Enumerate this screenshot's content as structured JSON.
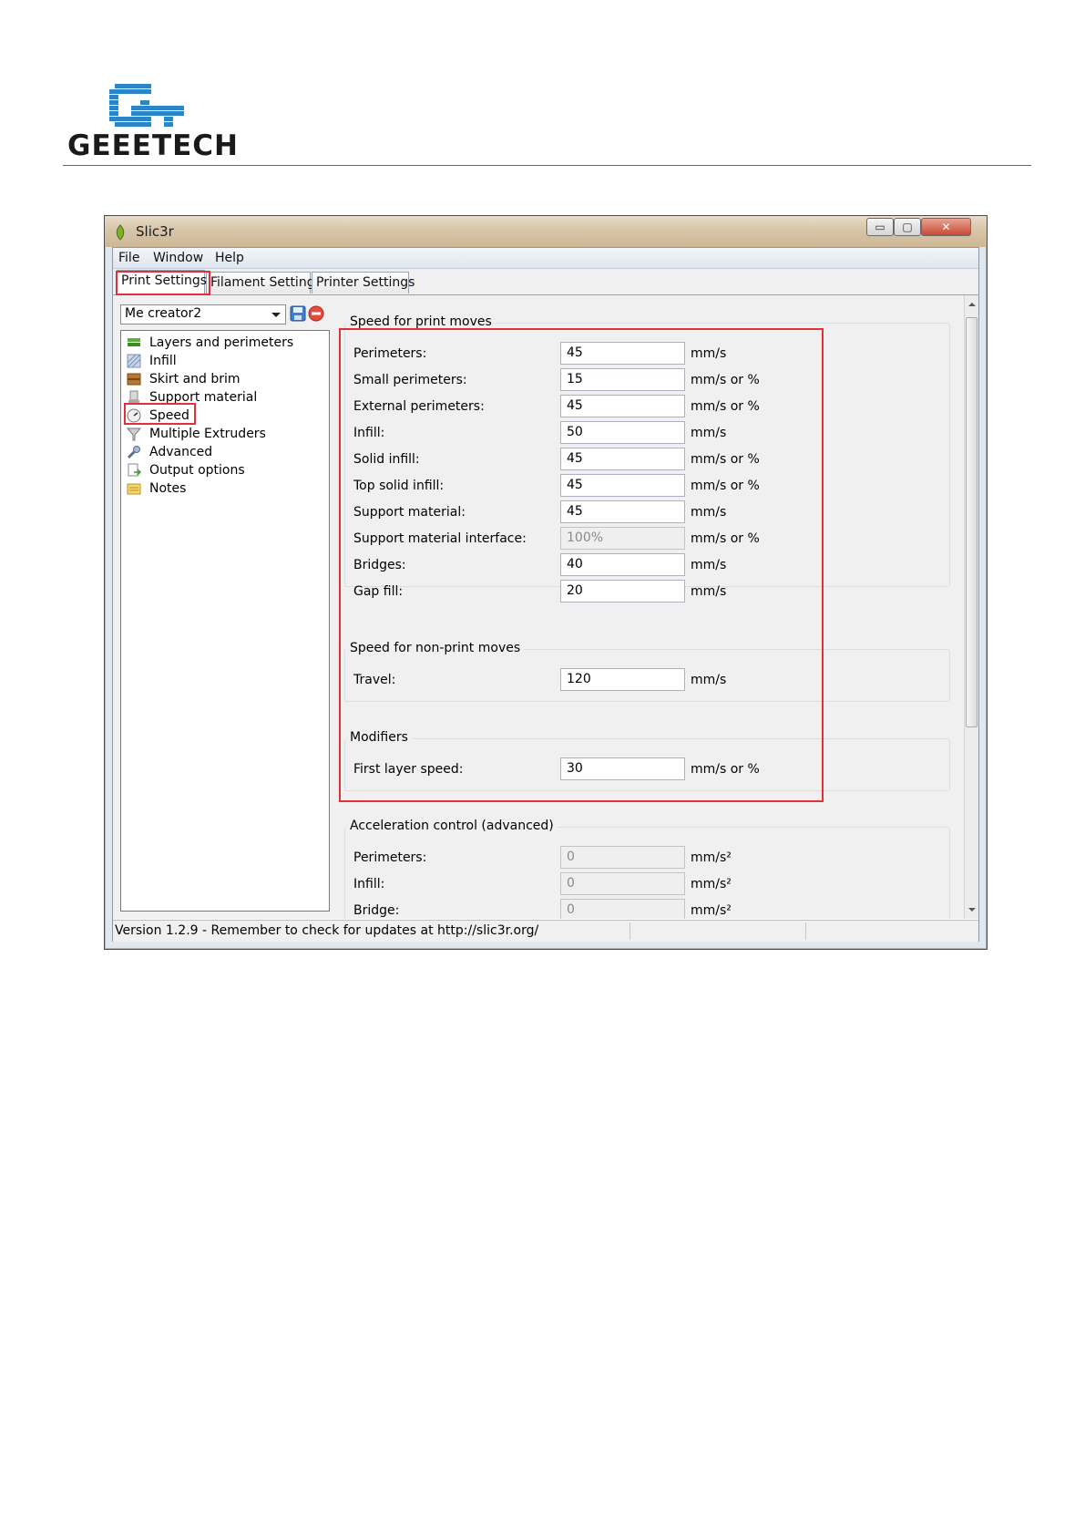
{
  "doc": {
    "logo_text": "GEEETECH"
  },
  "window": {
    "title": "Slic3r",
    "buttons": {
      "minimize": "▭",
      "maximize": "▢",
      "close": "✕"
    }
  },
  "menu": [
    "File",
    "Window",
    "Help"
  ],
  "tabs": [
    "Print Settings",
    "Filament Settings",
    "Printer Settings"
  ],
  "preset": {
    "selected": "Me creator2"
  },
  "sidebar": {
    "items": [
      {
        "label": "Layers and perimeters",
        "icon": "layers-icon"
      },
      {
        "label": "Infill",
        "icon": "infill-icon"
      },
      {
        "label": "Skirt and brim",
        "icon": "brim-icon"
      },
      {
        "label": "Support material",
        "icon": "support-icon"
      },
      {
        "label": "Speed",
        "icon": "speedometer-icon"
      },
      {
        "label": "Multiple Extruders",
        "icon": "funnel-icon"
      },
      {
        "label": "Advanced",
        "icon": "wrench-icon"
      },
      {
        "label": "Output options",
        "icon": "output-icon"
      },
      {
        "label": "Notes",
        "icon": "note-icon"
      }
    ]
  },
  "speed_print": {
    "title": "Speed for print moves",
    "rows": [
      {
        "label": "Perimeters:",
        "value": "45",
        "unit": "mm/s"
      },
      {
        "label": "Small perimeters:",
        "value": "15",
        "unit": "mm/s or %"
      },
      {
        "label": "External perimeters:",
        "value": "45",
        "unit": "mm/s or %"
      },
      {
        "label": "Infill:",
        "value": "50",
        "unit": "mm/s"
      },
      {
        "label": "Solid infill:",
        "value": "45",
        "unit": "mm/s or %"
      },
      {
        "label": "Top solid infill:",
        "value": "45",
        "unit": "mm/s or %"
      },
      {
        "label": "Support material:",
        "value": "45",
        "unit": "mm/s"
      },
      {
        "label": "Support material interface:",
        "value": "100%",
        "unit": "mm/s or %"
      },
      {
        "label": "Bridges:",
        "value": "40",
        "unit": "mm/s"
      },
      {
        "label": "Gap fill:",
        "value": "20",
        "unit": "mm/s"
      }
    ]
  },
  "speed_nonprint": {
    "title": "Speed for non-print moves",
    "rows": [
      {
        "label": "Travel:",
        "value": "120",
        "unit": "mm/s"
      }
    ]
  },
  "modifiers": {
    "title": "Modifiers",
    "rows": [
      {
        "label": "First layer speed:",
        "value": "30",
        "unit": "mm/s or %"
      }
    ]
  },
  "acceleration": {
    "title": "Acceleration control (advanced)",
    "rows": [
      {
        "label": "Perimeters:",
        "value": "0",
        "unit": "mm/s²"
      },
      {
        "label": "Infill:",
        "value": "0",
        "unit": "mm/s²"
      },
      {
        "label": "Bridge:",
        "value": "0",
        "unit": "mm/s²"
      }
    ]
  },
  "status": {
    "text": "Version 1.2.9 - Remember to check for updates at http://slic3r.org/"
  },
  "colors": {
    "highlight": "#e0303a",
    "titlebar": "#d8c5a8"
  }
}
